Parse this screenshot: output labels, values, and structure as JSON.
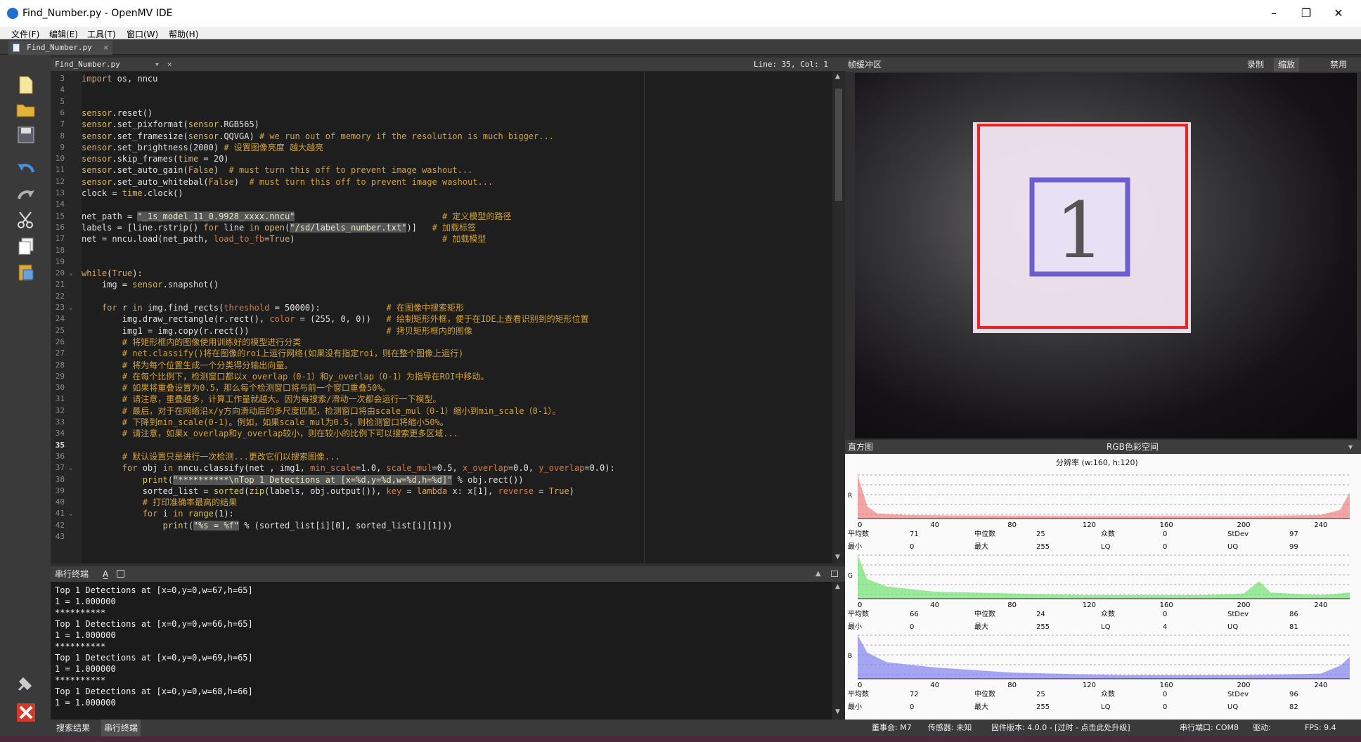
{
  "window": {
    "title": "Find_Number.py - OpenMV IDE",
    "minimize": "–",
    "restore": "❐",
    "close": "✕"
  },
  "menu": [
    "文件(F)",
    "编辑(E)",
    "工具(T)",
    "窗口(W)",
    "帮助(H)"
  ],
  "file_tab": {
    "name": "Find_Number.py",
    "close": "✕"
  },
  "editor": {
    "file": "Find_Number.py",
    "drop": "▾",
    "close": "✕",
    "position": "Line: 35, Col: 1"
  },
  "code_lines": [
    {
      "n": "3",
      "t": "import os, nncu"
    },
    {
      "n": "4",
      "t": ""
    },
    {
      "n": "5",
      "t": ""
    },
    {
      "n": "6",
      "t": "sensor.reset()"
    },
    {
      "n": "7",
      "t": "sensor.set_pixformat(sensor.RGB565)"
    },
    {
      "n": "8",
      "t": "sensor.set_framesize(sensor.QQVGA) # we run out of memory if the resolution is much bigger..."
    },
    {
      "n": "9",
      "t": "sensor.set_brightness(2000) # 设置图像亮度 越大越亮"
    },
    {
      "n": "10",
      "t": "sensor.skip_frames(time = 20)"
    },
    {
      "n": "11",
      "t": "sensor.set_auto_gain(False)  # must turn this off to prevent image washout..."
    },
    {
      "n": "12",
      "t": "sensor.set_auto_whitebal(False)  # must turn this off to prevent image washout..."
    },
    {
      "n": "13",
      "t": "clock = time.clock()"
    },
    {
      "n": "14",
      "t": ""
    },
    {
      "n": "15",
      "t": "net_path = \"_1s_model_11_0.9928_xxxx.nncu\"                             # 定义模型的路径"
    },
    {
      "n": "16",
      "t": "labels = [line.rstrip() for line in open(\"/sd/labels_number.txt\")]   # 加载标签"
    },
    {
      "n": "17",
      "t": "net = nncu.load(net_path, load_to_fb=True)                             # 加载模型"
    },
    {
      "n": "18",
      "t": ""
    },
    {
      "n": "19",
      "t": ""
    },
    {
      "n": "20",
      "t": "while(True):"
    },
    {
      "n": "21",
      "t": "    img = sensor.snapshot()"
    },
    {
      "n": "22",
      "t": ""
    },
    {
      "n": "23",
      "t": "    for r in img.find_rects(threshold = 50000):             # 在图像中搜索矩形"
    },
    {
      "n": "24",
      "t": "        img.draw_rectangle(r.rect(), color = (255, 0, 0))   # 绘制矩形外框，便于在IDE上查看识别到的矩形位置"
    },
    {
      "n": "25",
      "t": "        img1 = img.copy(r.rect())                           # 拷贝矩形框内的图像"
    },
    {
      "n": "26",
      "t": "        # 将矩形框内的图像使用训练好的模型进行分类"
    },
    {
      "n": "27",
      "t": "        # net.classify()将在图像的roi上运行网络(如果没有指定roi，则在整个图像上运行)"
    },
    {
      "n": "28",
      "t": "        # 将为每个位置生成一个分类得分输出向量。"
    },
    {
      "n": "29",
      "t": "        # 在每个比例下，检测窗口都以x_overlap（0-1）和y_overlap（0-1）为指导在ROI中移动。"
    },
    {
      "n": "30",
      "t": "        # 如果将重叠设置为0.5，那么每个检测窗口将与前一个窗口重叠50%。"
    },
    {
      "n": "31",
      "t": "        # 请注意，重叠越多，计算工作量就越大。因为每搜索/滑动一次都会运行一下模型。"
    },
    {
      "n": "32",
      "t": "        # 最后，对于在网络沿x/y方向滑动后的多尺度匹配，检测窗口将由scale_mul（0-1）缩小到min_scale（0-1）。"
    },
    {
      "n": "33",
      "t": "        # 下降到min_scale(0-1)。例如，如果scale_mul为0.5，则检测窗口将缩小50%。"
    },
    {
      "n": "34",
      "t": "        # 请注意，如果x_overlap和y_overlap较小，则在较小的比例下可以搜索更多区域..."
    },
    {
      "n": "35",
      "t": ""
    },
    {
      "n": "36",
      "t": "        # 默认设置只是进行一次检测...更改它们以搜索图像..."
    },
    {
      "n": "37",
      "t": "        for obj in nncu.classify(net , img1, min_scale=1.0, scale_mul=0.5, x_overlap=0.0, y_overlap=0.0):"
    },
    {
      "n": "38",
      "t": "            print(\"**********\\nTop 1 Detections at [x=%d,y=%d,w=%d,h=%d]\" % obj.rect())"
    },
    {
      "n": "39",
      "t": "            sorted_list = sorted(zip(labels, obj.output()), key = lambda x: x[1], reverse = True)"
    },
    {
      "n": "40",
      "t": "            # 打印准确率最高的结果"
    },
    {
      "n": "41",
      "t": "            for i in range(1):"
    },
    {
      "n": "42",
      "t": "                print(\"%s = %f\" % (sorted_list[i][0], sorted_list[i][1]))"
    },
    {
      "n": "43",
      "t": ""
    }
  ],
  "terminal": {
    "title": "串行终端",
    "lines": [
      "Top 1 Detections at [x=0,y=0,w=67,h=65]",
      "1 = 1.000000",
      "**********",
      "Top 1 Detections at [x=0,y=0,w=66,h=65]",
      "1 = 1.000000",
      "**********",
      "Top 1 Detections at [x=0,y=0,w=69,h=65]",
      "1 = 1.000000",
      "**********",
      "Top 1 Detections at [x=0,y=0,w=68,h=66]",
      "1 = 1.000000"
    ]
  },
  "bottom_tabs": [
    "搜索结果",
    "串行终端"
  ],
  "framebuffer": {
    "title": "帧缓冲区",
    "buttons": [
      "录制",
      "缩放",
      "禁用"
    ],
    "digit": "1"
  },
  "histogram": {
    "title": "直方图",
    "colorspace": "RGB色彩空间",
    "dropdown": "▾",
    "resolution": "分辨率 (w:160, h:120)",
    "ticks": [
      "0",
      "40",
      "80",
      "120",
      "160",
      "200",
      "240"
    ],
    "labels": {
      "mean": "平均数",
      "median": "中位数",
      "mode": "众数",
      "stdev": "StDev",
      "min": "最小",
      "max": "最大",
      "lq": "LQ",
      "uq": "UQ"
    },
    "channels": [
      {
        "name": "R",
        "color": "#f08080",
        "mean": "71",
        "median": "25",
        "mode": "0",
        "stdev": "97",
        "min": "0",
        "max": "255",
        "lq": "0",
        "uq": "99"
      },
      {
        "name": "G",
        "color": "#70e070",
        "mean": "66",
        "median": "24",
        "mode": "0",
        "stdev": "86",
        "min": "0",
        "max": "255",
        "lq": "4",
        "uq": "81"
      },
      {
        "name": "B",
        "color": "#8080f0",
        "mean": "72",
        "median": "25",
        "mode": "0",
        "stdev": "96",
        "min": "0",
        "max": "255",
        "lq": "0",
        "uq": "82"
      }
    ]
  },
  "status": {
    "board": "董事会: M7",
    "sensor": "传感器: 未知",
    "firmware": "固件版本: 4.0.0 - [过时 - 点击此处升级]",
    "port": "串行端口: COM8",
    "driver": "驱动:",
    "fps": "FPS: 9.4"
  }
}
